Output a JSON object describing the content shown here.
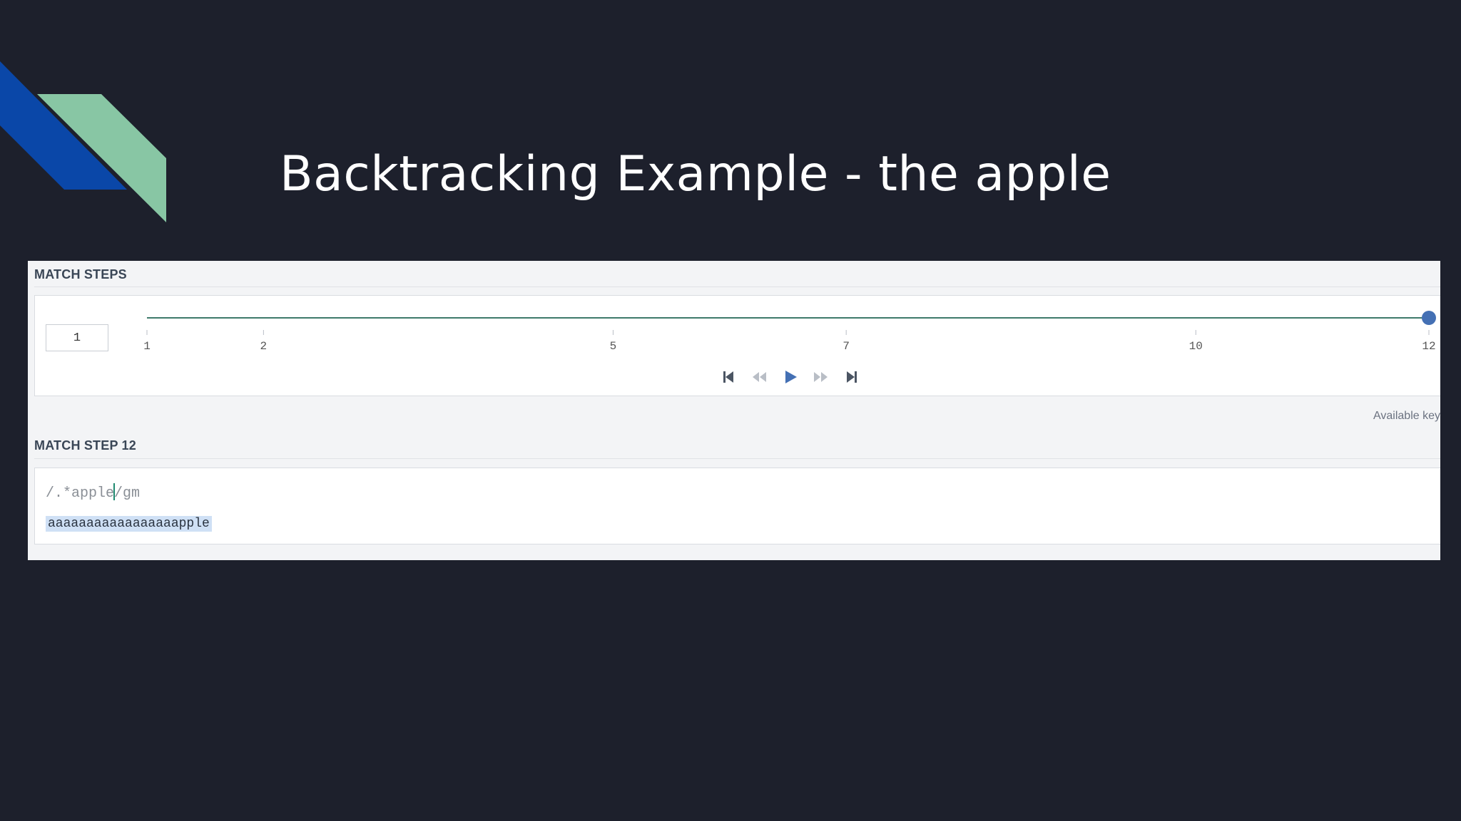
{
  "slide": {
    "title": "Backtracking Example - the apple"
  },
  "colors": {
    "background": "#1d202c",
    "deco_blue": "#0a47a8",
    "deco_green": "#88c6a4",
    "accent": "#4470b4",
    "track": "#3f7a6a",
    "highlight": "#cfe0f5"
  },
  "match_steps": {
    "header": "MATCH STEPS",
    "current_step": "1",
    "tick_labels": [
      "1",
      "2",
      "5",
      "7",
      "10",
      "12"
    ],
    "slider_value": 12,
    "slider_max": 12,
    "controls": {
      "first": "skip-to-start-icon",
      "back": "step-back-icon",
      "play": "play-icon",
      "forward": "step-forward-icon",
      "last": "skip-to-end-icon"
    },
    "keys_hint": "Available key"
  },
  "match_step_detail": {
    "header": "MATCH STEP 12",
    "regex_before_cursor": "/.*apple",
    "regex_after_cursor": "/gm",
    "subject": "aaaaaaaaaaaaaaaaapple"
  }
}
